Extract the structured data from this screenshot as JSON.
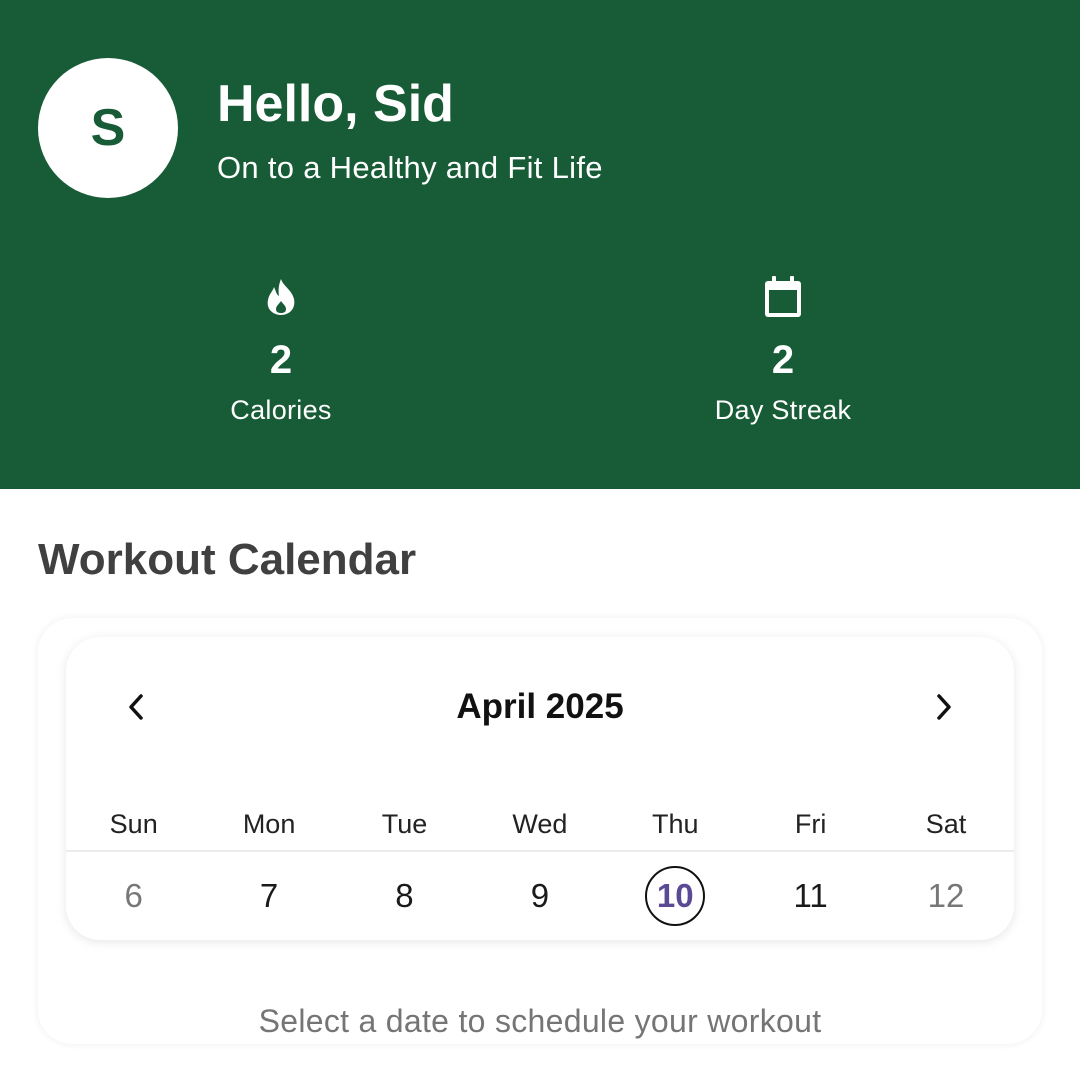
{
  "user": {
    "initial": "S",
    "greeting": "Hello, Sid",
    "tagline": "On to a Healthy and Fit Life"
  },
  "stats": {
    "calories": {
      "icon": "flame-icon",
      "value": "2",
      "label": "Calories"
    },
    "streak": {
      "icon": "calendar-icon",
      "value": "2",
      "label": "Day Streak"
    }
  },
  "section": {
    "title": "Workout Calendar"
  },
  "calendar": {
    "month_label": "April 2025",
    "weekdays": [
      "Sun",
      "Mon",
      "Tue",
      "Wed",
      "Thu",
      "Fri",
      "Sat"
    ],
    "days": [
      "6",
      "7",
      "8",
      "9",
      "10",
      "11",
      "12"
    ],
    "selected_day": "10"
  },
  "hint": "Select a date to schedule your workout",
  "colors": {
    "header_bg": "#175c36",
    "selected_day_text": "#5a4a95",
    "title_text": "#404040"
  }
}
